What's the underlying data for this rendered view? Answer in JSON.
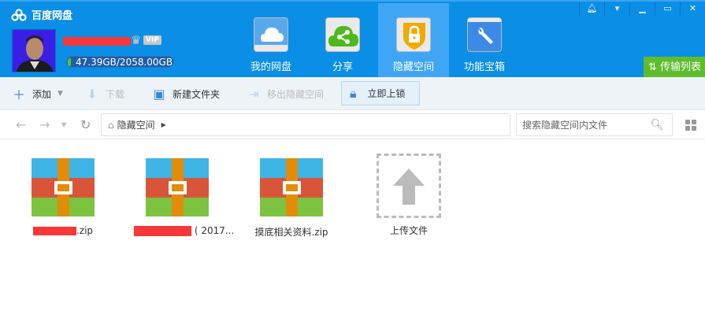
{
  "app": {
    "title": "百度网盘"
  },
  "user": {
    "quota": "47.39GB/2058.00GB",
    "quota_used_fraction": 0.023,
    "vip_label": "VIP"
  },
  "nav": [
    {
      "label": "我的网盘"
    },
    {
      "label": "分享"
    },
    {
      "label": "隐藏空间"
    },
    {
      "label": "功能宝箱"
    }
  ],
  "transfer_label": "传输列表",
  "toolbar": {
    "add": "添加",
    "download": "下载",
    "new_folder": "新建文件夹",
    "move_out": "移出隐藏空间",
    "lock": "立即上锁"
  },
  "breadcrumb": {
    "current": "隐藏空间"
  },
  "search": {
    "placeholder": "搜索隐藏空间内文件"
  },
  "files": [
    {
      "suffix": ".zip"
    },
    {
      "suffix": "( 2017..."
    },
    {
      "name": "摸底相关资料.zip"
    }
  ],
  "upload_label": "上传文件",
  "colors": {
    "header": "#0a8ee6",
    "active_nav": "#3fa6f6",
    "transfer": "#5fbd2c"
  }
}
